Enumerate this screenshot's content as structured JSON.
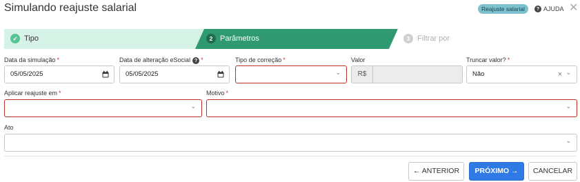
{
  "header": {
    "title": "Simulando reajuste salarial",
    "badge": "Reajuste salarial",
    "help_label": "AJUDA",
    "help_icon_glyph": "?",
    "close_glyph": "✕"
  },
  "stepper": {
    "steps": [
      {
        "label": "Tipo",
        "state": "completed",
        "icon_glyph": "✓"
      },
      {
        "number": "2",
        "label": "Parâmetros",
        "state": "active"
      },
      {
        "number": "3",
        "label": "Filtrar por",
        "state": "pending"
      }
    ]
  },
  "form": {
    "data_simulacao": {
      "label": "Data da simulação",
      "required": "*",
      "value": "05/05/2025"
    },
    "data_alteracao": {
      "label": "Data de alteração eSocial",
      "required": "*",
      "value": "05/05/2025",
      "info_glyph": "?"
    },
    "tipo_correcao": {
      "label": "Tipo de correção",
      "required": "*",
      "value": ""
    },
    "valor": {
      "label": "Valor",
      "prefix": "R$",
      "value": ""
    },
    "truncar": {
      "label": "Truncar valor?",
      "required": "*",
      "value": "Não",
      "clear_glyph": "×"
    },
    "aplicar": {
      "label": "Aplicar reajuste em",
      "required": "*",
      "value": ""
    },
    "motivo": {
      "label": "Motivo",
      "required": "*",
      "value": ""
    },
    "ato": {
      "label": "Ato",
      "value": ""
    },
    "chevron_glyph": "⌄"
  },
  "footer": {
    "prev_label": "ANTERIOR",
    "next_label": "PRÓXIMO",
    "cancel_label": "CANCELAR",
    "prev_arrow": "🡐",
    "next_arrow": "→"
  },
  "colors": {
    "step_completed_bg": "#d7f2e6",
    "step_active_bg": "#2f9a72",
    "step_check": "#58c495",
    "error_border": "#b8322a",
    "primary": "#2f7ae5",
    "badge_bg": "#7fc2cf"
  }
}
